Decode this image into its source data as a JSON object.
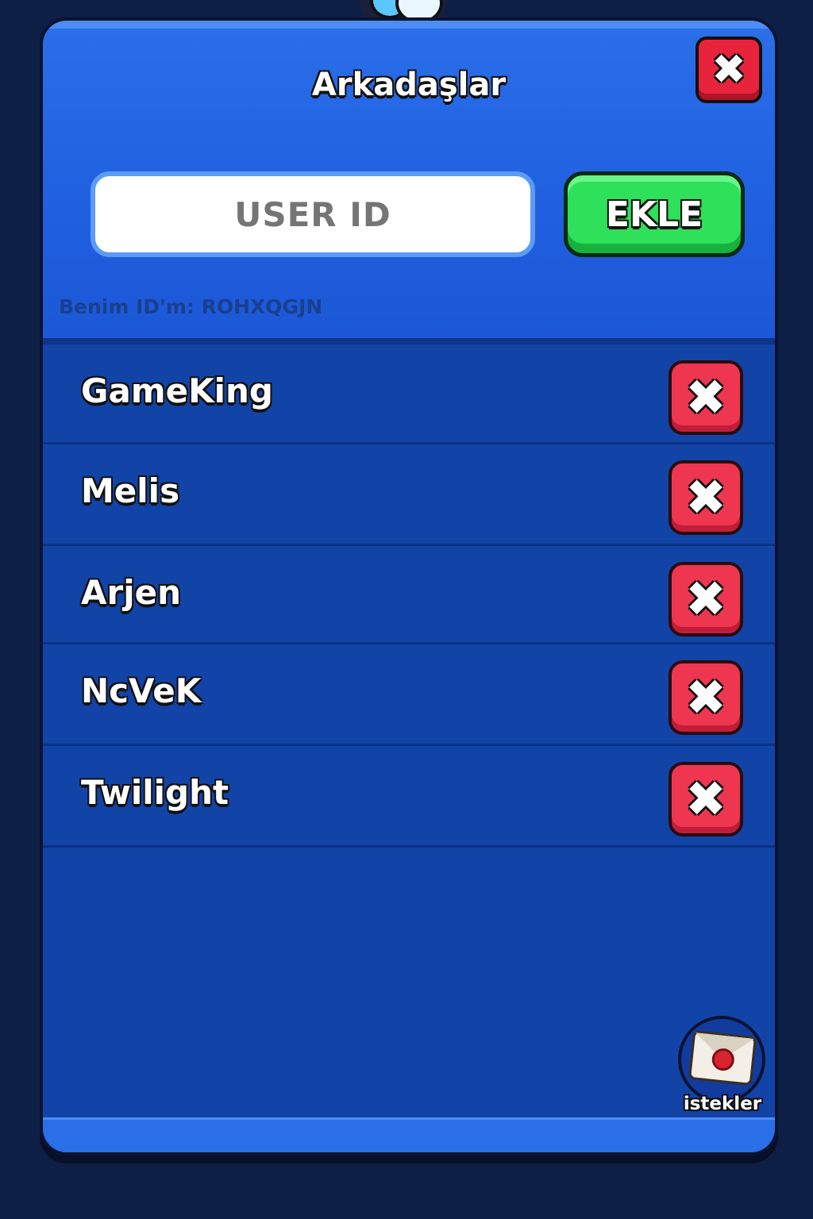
{
  "dialog": {
    "title": "Arkadaşlar",
    "close_icon": "close-icon"
  },
  "add_friend": {
    "input_placeholder": "USER ID",
    "add_label": "EKLE",
    "my_id_text": "Benim ID'm: ROHXQGJN"
  },
  "friends": [
    {
      "name": "GameKing"
    },
    {
      "name": "Melis"
    },
    {
      "name": "Arjen"
    },
    {
      "name": "NcVeK"
    },
    {
      "name": "Twilight"
    }
  ],
  "requests": {
    "label": "istekler",
    "icon": "envelope-icon"
  },
  "colors": {
    "panel": "#1244a8",
    "header": "#1f5fe0",
    "add_button": "#2ee05a",
    "remove_button": "#ef3651"
  }
}
